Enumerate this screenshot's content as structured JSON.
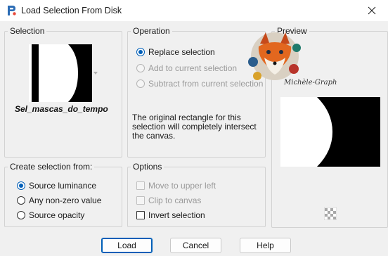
{
  "window": {
    "title": "Load Selection From Disk",
    "icon": "paintshop-pro-icon",
    "close_icon": "close-icon"
  },
  "selection": {
    "group_label": "Selection",
    "name": "Sel_mascas_do_tempo"
  },
  "operation": {
    "group_label": "Operation",
    "options": [
      {
        "label": "Replace selection",
        "checked": true,
        "enabled": true
      },
      {
        "label": "Add to current selection",
        "checked": false,
        "enabled": false
      },
      {
        "label": "Subtract from current selection",
        "checked": false,
        "enabled": false
      }
    ],
    "description": "The original rectangle for this selection will completely intersect the canvas."
  },
  "preview": {
    "group_label": "Preview",
    "watermark_text": "Michèle-Graph"
  },
  "create_from": {
    "group_label": "Create selection from:",
    "options": [
      {
        "label": "Source luminance",
        "checked": true
      },
      {
        "label": "Any non-zero value",
        "checked": false
      },
      {
        "label": "Source opacity",
        "checked": false
      }
    ]
  },
  "options": {
    "group_label": "Options",
    "items": [
      {
        "label": "Move to upper left",
        "checked": false,
        "enabled": false
      },
      {
        "label": "Clip to canvas",
        "checked": false,
        "enabled": false
      },
      {
        "label": "Invert selection",
        "checked": false,
        "enabled": true
      }
    ]
  },
  "buttons": {
    "load": "Load",
    "cancel": "Cancel",
    "help": "Help"
  },
  "colors": {
    "accent": "#005fb8",
    "window_bg": "#f0f0f0"
  }
}
